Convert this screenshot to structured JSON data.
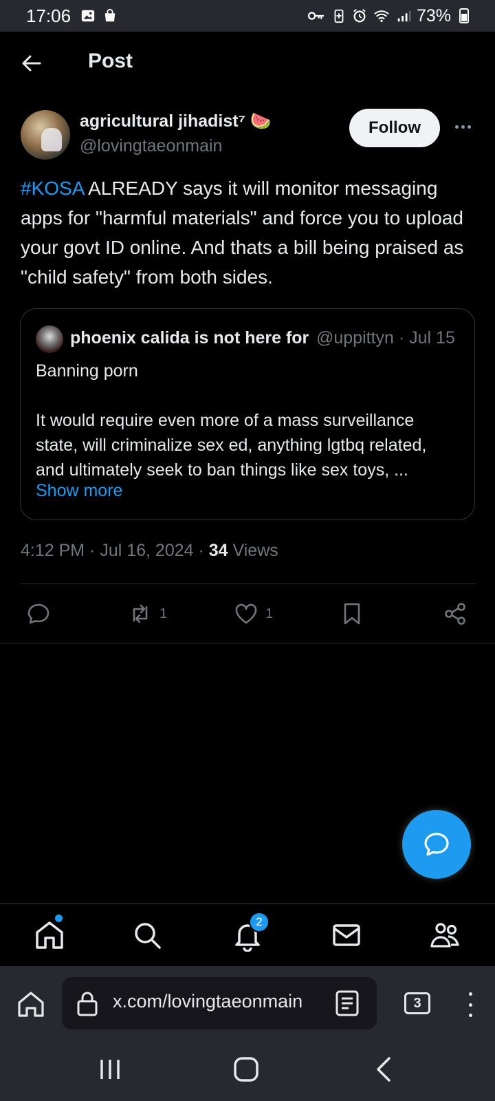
{
  "status_bar": {
    "time": "17:06",
    "battery_percent": "73%",
    "left_icons": [
      "image-icon",
      "shopping-bag-icon"
    ],
    "right_icons": [
      "vpn-key-icon",
      "battery-saver-icon",
      "alarm-icon",
      "wifi-icon",
      "signal-icon",
      "battery-icon"
    ]
  },
  "header": {
    "title": "Post"
  },
  "post": {
    "author_name": "agricultural jihadist⁷ 🍉",
    "author_handle": "@lovingtaeonmain",
    "follow_label": "Follow",
    "text_hashtag": "#KOSA",
    "text_body": " ALREADY says it will monitor messaging apps for \"harmful materials\" and force you to upload your govt ID online. And thats a bill being praised as \"child safety\" from both sides.",
    "timestamp": "4:12 PM · Jul 16, 2024 · ",
    "views_count": "34",
    "views_label": " Views"
  },
  "quote": {
    "author_name": "phoenix calida is not here for",
    "meta": "@uppittyn · Jul 15",
    "line1": "Banning porn",
    "line2": "It would require even more of a mass surveillance",
    "line3": "state, will criminalize sex ed, anything lgtbq related,",
    "line4": "and ultimately seek to ban things like sex toys, ...",
    "show_more": "Show more"
  },
  "actions": {
    "reply_count": "",
    "repost_count": "1",
    "like_count": "1"
  },
  "bottom_nav": {
    "notification_badge": "2",
    "items": [
      "home-icon",
      "search-icon",
      "bell-icon",
      "mail-icon",
      "communities-icon"
    ]
  },
  "browser": {
    "url": "x.com/lovingtaeonmain",
    "tab_count": "3"
  },
  "colors": {
    "accent": "#1d9bf0",
    "background": "#000000",
    "muted_text": "#71767b",
    "divider": "#2f3336"
  }
}
